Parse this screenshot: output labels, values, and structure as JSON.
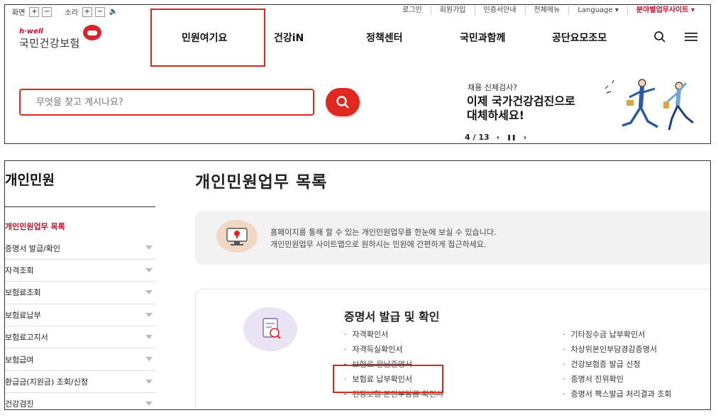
{
  "utility": {
    "screen_label": "화면",
    "sound_label": "소리",
    "plus": "+",
    "minus": "−",
    "speaker": "🔈",
    "links": [
      "로그인",
      "회원가입",
      "인증서안내",
      "전체메뉴",
      "Language ▾",
      "분야별업무사이트 ▾"
    ]
  },
  "logo": {
    "hwell": "h·well",
    "name": "국민건강보험"
  },
  "gnb": [
    "민원여기요",
    "건강iN",
    "정책센터",
    "국민과함께",
    "공단요모조모"
  ],
  "search": {
    "placeholder": "무엇을 찾고 계시나요?"
  },
  "banner": {
    "sub": "채용 신체검사?",
    "title_line1": "이제 국가건강검진으로",
    "title_line2": "대체하세요!",
    "page": "4 / 13",
    "prev": "‹",
    "pause": "❚❚",
    "next": "›"
  },
  "sidebar": {
    "title": "개인민원",
    "items": [
      "개인민원업무 목록",
      "증명서 발급/확인",
      "자격조회",
      "보험료조회",
      "보험료납부",
      "보험료고지서",
      "보험급여",
      "환급금(지원금) 조회/신청",
      "건강검진"
    ]
  },
  "main": {
    "title": "개인민원업무 목록",
    "info_line1": "홈페이지를 통해 할 수 있는 개인민원업무를 한눈에 보실 수 있습니다.",
    "info_line2": "개인민원업무 사이트맵으로 원하시는 민원에 간편하게 접근하세요.",
    "section_title": "증명서 발급 및 확인",
    "left_links": [
      "자격확인서",
      "자격득실확인서",
      "보험료 완납증명서",
      "보험료 납부확인서",
      "건강보험 본인부담금 확인서"
    ],
    "right_links": [
      "기타징수금 납부확인서",
      "차상위본인부담경감증명서",
      "건강보험증 발급 신청",
      "증명서 진위확인",
      "증명서 팩스발급 처리결과 조회"
    ]
  },
  "colors": {
    "accent": "#d52b1e",
    "brand_red": "#c8102e"
  }
}
